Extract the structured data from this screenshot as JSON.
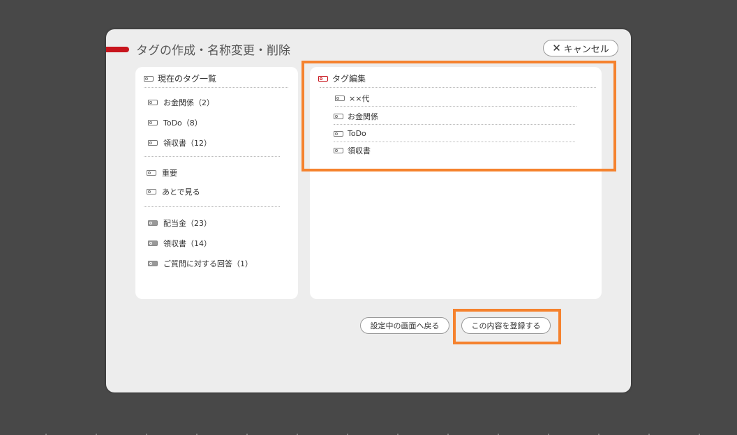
{
  "dialog": {
    "title": "タグの作成・名称変更・削除",
    "cancel_label": "キャンセル"
  },
  "left_panel": {
    "heading": "現在のタグ一覧",
    "group1": [
      {
        "label": "お金関係（2）"
      },
      {
        "label": "ToDo（8）"
      },
      {
        "label": "領収書（12）"
      }
    ],
    "group2": [
      {
        "label": "重要"
      },
      {
        "label": "あとで見る"
      }
    ],
    "group3": [
      {
        "label": "配当金（23）"
      },
      {
        "label": "領収書（14）"
      },
      {
        "label": "ご質問に対する回答（1）"
      }
    ]
  },
  "right_panel": {
    "heading": "タグ編集",
    "items": [
      {
        "label": "××代"
      },
      {
        "label": "お金関係"
      },
      {
        "label": "ToDo"
      },
      {
        "label": "領収書"
      }
    ]
  },
  "footer": {
    "back_label": "設定中の画面へ戻る",
    "register_label": "この内容を登録する"
  },
  "colors": {
    "accent_red": "#c8151d",
    "highlight_orange": "#f5822e",
    "backdrop": "#484848",
    "dialog_bg": "#ededed"
  },
  "icons": {
    "tag": "tag-icon",
    "tag_red": "tag-red-icon",
    "tag_shared": "shared-tag-icon",
    "close": "close-x-icon"
  }
}
